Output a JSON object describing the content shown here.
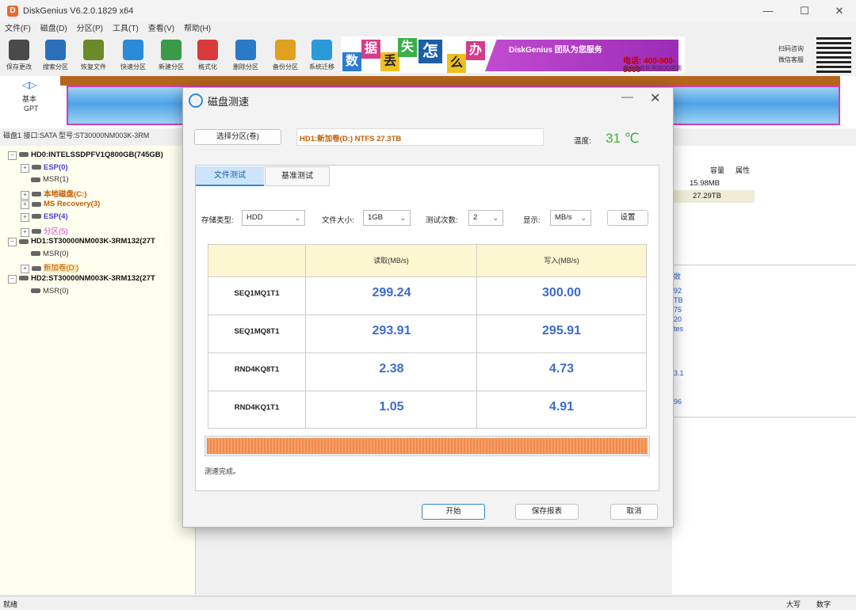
{
  "window": {
    "title": "DiskGenius V6.2.0.1829 x64",
    "logo": "D",
    "min": "—",
    "max": "☐",
    "close": "✕"
  },
  "menu": [
    "文件(F)",
    "磁盘(D)",
    "分区(P)",
    "工具(T)",
    "查看(V)",
    "帮助(H)"
  ],
  "toolbar": [
    {
      "label": "保存更改",
      "icon": "save-icon",
      "color": "#4a4a4a"
    },
    {
      "label": "搜索分区",
      "icon": "search-icon",
      "color": "#2a6fb8"
    },
    {
      "label": "恢复文件",
      "icon": "recover-icon",
      "color": "#6b8a2a"
    },
    {
      "label": "快速分区",
      "icon": "quick-partition-icon",
      "color": "#2a8bd8"
    },
    {
      "label": "新建分区",
      "icon": "new-partition-icon",
      "color": "#3a9a4a"
    },
    {
      "label": "格式化",
      "icon": "format-icon",
      "color": "#d83a3a"
    },
    {
      "label": "删除分区",
      "icon": "delete-icon",
      "color": "#2a7ac8"
    },
    {
      "label": "备份分区",
      "icon": "backup-icon",
      "color": "#e0a020"
    },
    {
      "label": "系统迁移",
      "icon": "migrate-icon",
      "color": "#2a9ad8"
    }
  ],
  "banner": {
    "chars": [
      "数",
      "据",
      "丢",
      "失",
      "怎",
      "么",
      "办"
    ],
    "slogan": "DiskGenius 团队为您服务",
    "phone": "电话: 400-900-5080",
    "qq": "或点击此处添加QQ咨询"
  },
  "qr": {
    "line1": "扫码咨询",
    "line2": "微信客服"
  },
  "disk": {
    "nav_left": "◁",
    "nav_right": "▷",
    "basic": "基本",
    "gpt": "GPT",
    "info": "磁盘1 接口:SATA  型号:ST30000NM003K-3RM"
  },
  "tree": [
    {
      "label": "HD0:INTELSSDPFV1Q800GB(745GB)",
      "level": 0,
      "color": "#111",
      "bold": true,
      "exp": "⊟"
    },
    {
      "label": "ESP(0)",
      "level": 1,
      "color": "#4a3ad8",
      "bold": true,
      "exp": "⊞"
    },
    {
      "label": "MSR(1)",
      "level": 1,
      "color": "#333",
      "bold": false,
      "exp": ""
    },
    {
      "label": "本地磁盘(C:)",
      "level": 1,
      "color": "#c75b00",
      "bold": true,
      "exp": "⊞"
    },
    {
      "label": "MS Recovery(3)",
      "level": 1,
      "color": "#c75b00",
      "bold": true,
      "exp": "⊞"
    },
    {
      "label": "ESP(4)",
      "level": 1,
      "color": "#4a3ad8",
      "bold": true,
      "exp": "⊞"
    },
    {
      "label": "分区(5)",
      "level": 1,
      "color": "#d83ad0",
      "bold": false,
      "exp": "⊞"
    },
    {
      "label": "HD1:ST30000NM003K-3RM132(27T",
      "level": 0,
      "color": "#111",
      "bold": true,
      "exp": "⊟"
    },
    {
      "label": "MSR(0)",
      "level": 1,
      "color": "#333",
      "bold": false,
      "exp": ""
    },
    {
      "label": "新加卷(D:)",
      "level": 1,
      "color": "#c75b00",
      "bold": false,
      "exp": "⊞"
    },
    {
      "label": "HD2:ST30000NM003K-3RM132(27T",
      "level": 0,
      "color": "#111",
      "bold": true,
      "exp": "⊟"
    },
    {
      "label": "MSR(0)",
      "level": 1,
      "color": "#333",
      "bold": false,
      "exp": ""
    }
  ],
  "right_panel": {
    "col_size": "容量",
    "col_attr": "属性",
    "row1": "15.98MB",
    "row2": "27.29TB",
    "frag1": "敚",
    "frag2": "92",
    "frag3": "TB",
    "frag4": "75",
    "frag5": "20",
    "frag6": "tes",
    "frag7": "3.1",
    "frag8": "96"
  },
  "status": {
    "left": "就绪",
    "caps": "大写",
    "num": "数字"
  },
  "dialog": {
    "title": "磁盘测速",
    "select_partition": "选择分区(卷)",
    "partition": "HD1:新加卷(D:) NTFS 27.3TB",
    "temp_label": "温度:",
    "temp_value": "31 ℃",
    "tabs": [
      "文件测试",
      "基准测试"
    ],
    "options": {
      "storage_label": "存储类型:",
      "storage": "HDD",
      "size_label": "文件大小:",
      "size": "1GB",
      "count_label": "测试次数:",
      "count": "2",
      "display_label": "显示:",
      "display": "MB/s",
      "settings": "设置"
    },
    "table": {
      "col_read": "读取(MB/s)",
      "col_write": "写入(MB/s)",
      "rows": [
        {
          "name": "SEQ1MQ1T1",
          "read": "299.24",
          "write": "300.00"
        },
        {
          "name": "SEQ1MQ8T1",
          "read": "293.91",
          "write": "295.91"
        },
        {
          "name": "RND4KQ8T1",
          "read": "2.38",
          "write": "4.73"
        },
        {
          "name": "RND4KQ1T1",
          "read": "1.05",
          "write": "4.91"
        }
      ]
    },
    "progress": 1.0,
    "status": "测速完成。",
    "buttons": {
      "start": "开始",
      "save": "保存报表",
      "cancel": "取消"
    }
  }
}
